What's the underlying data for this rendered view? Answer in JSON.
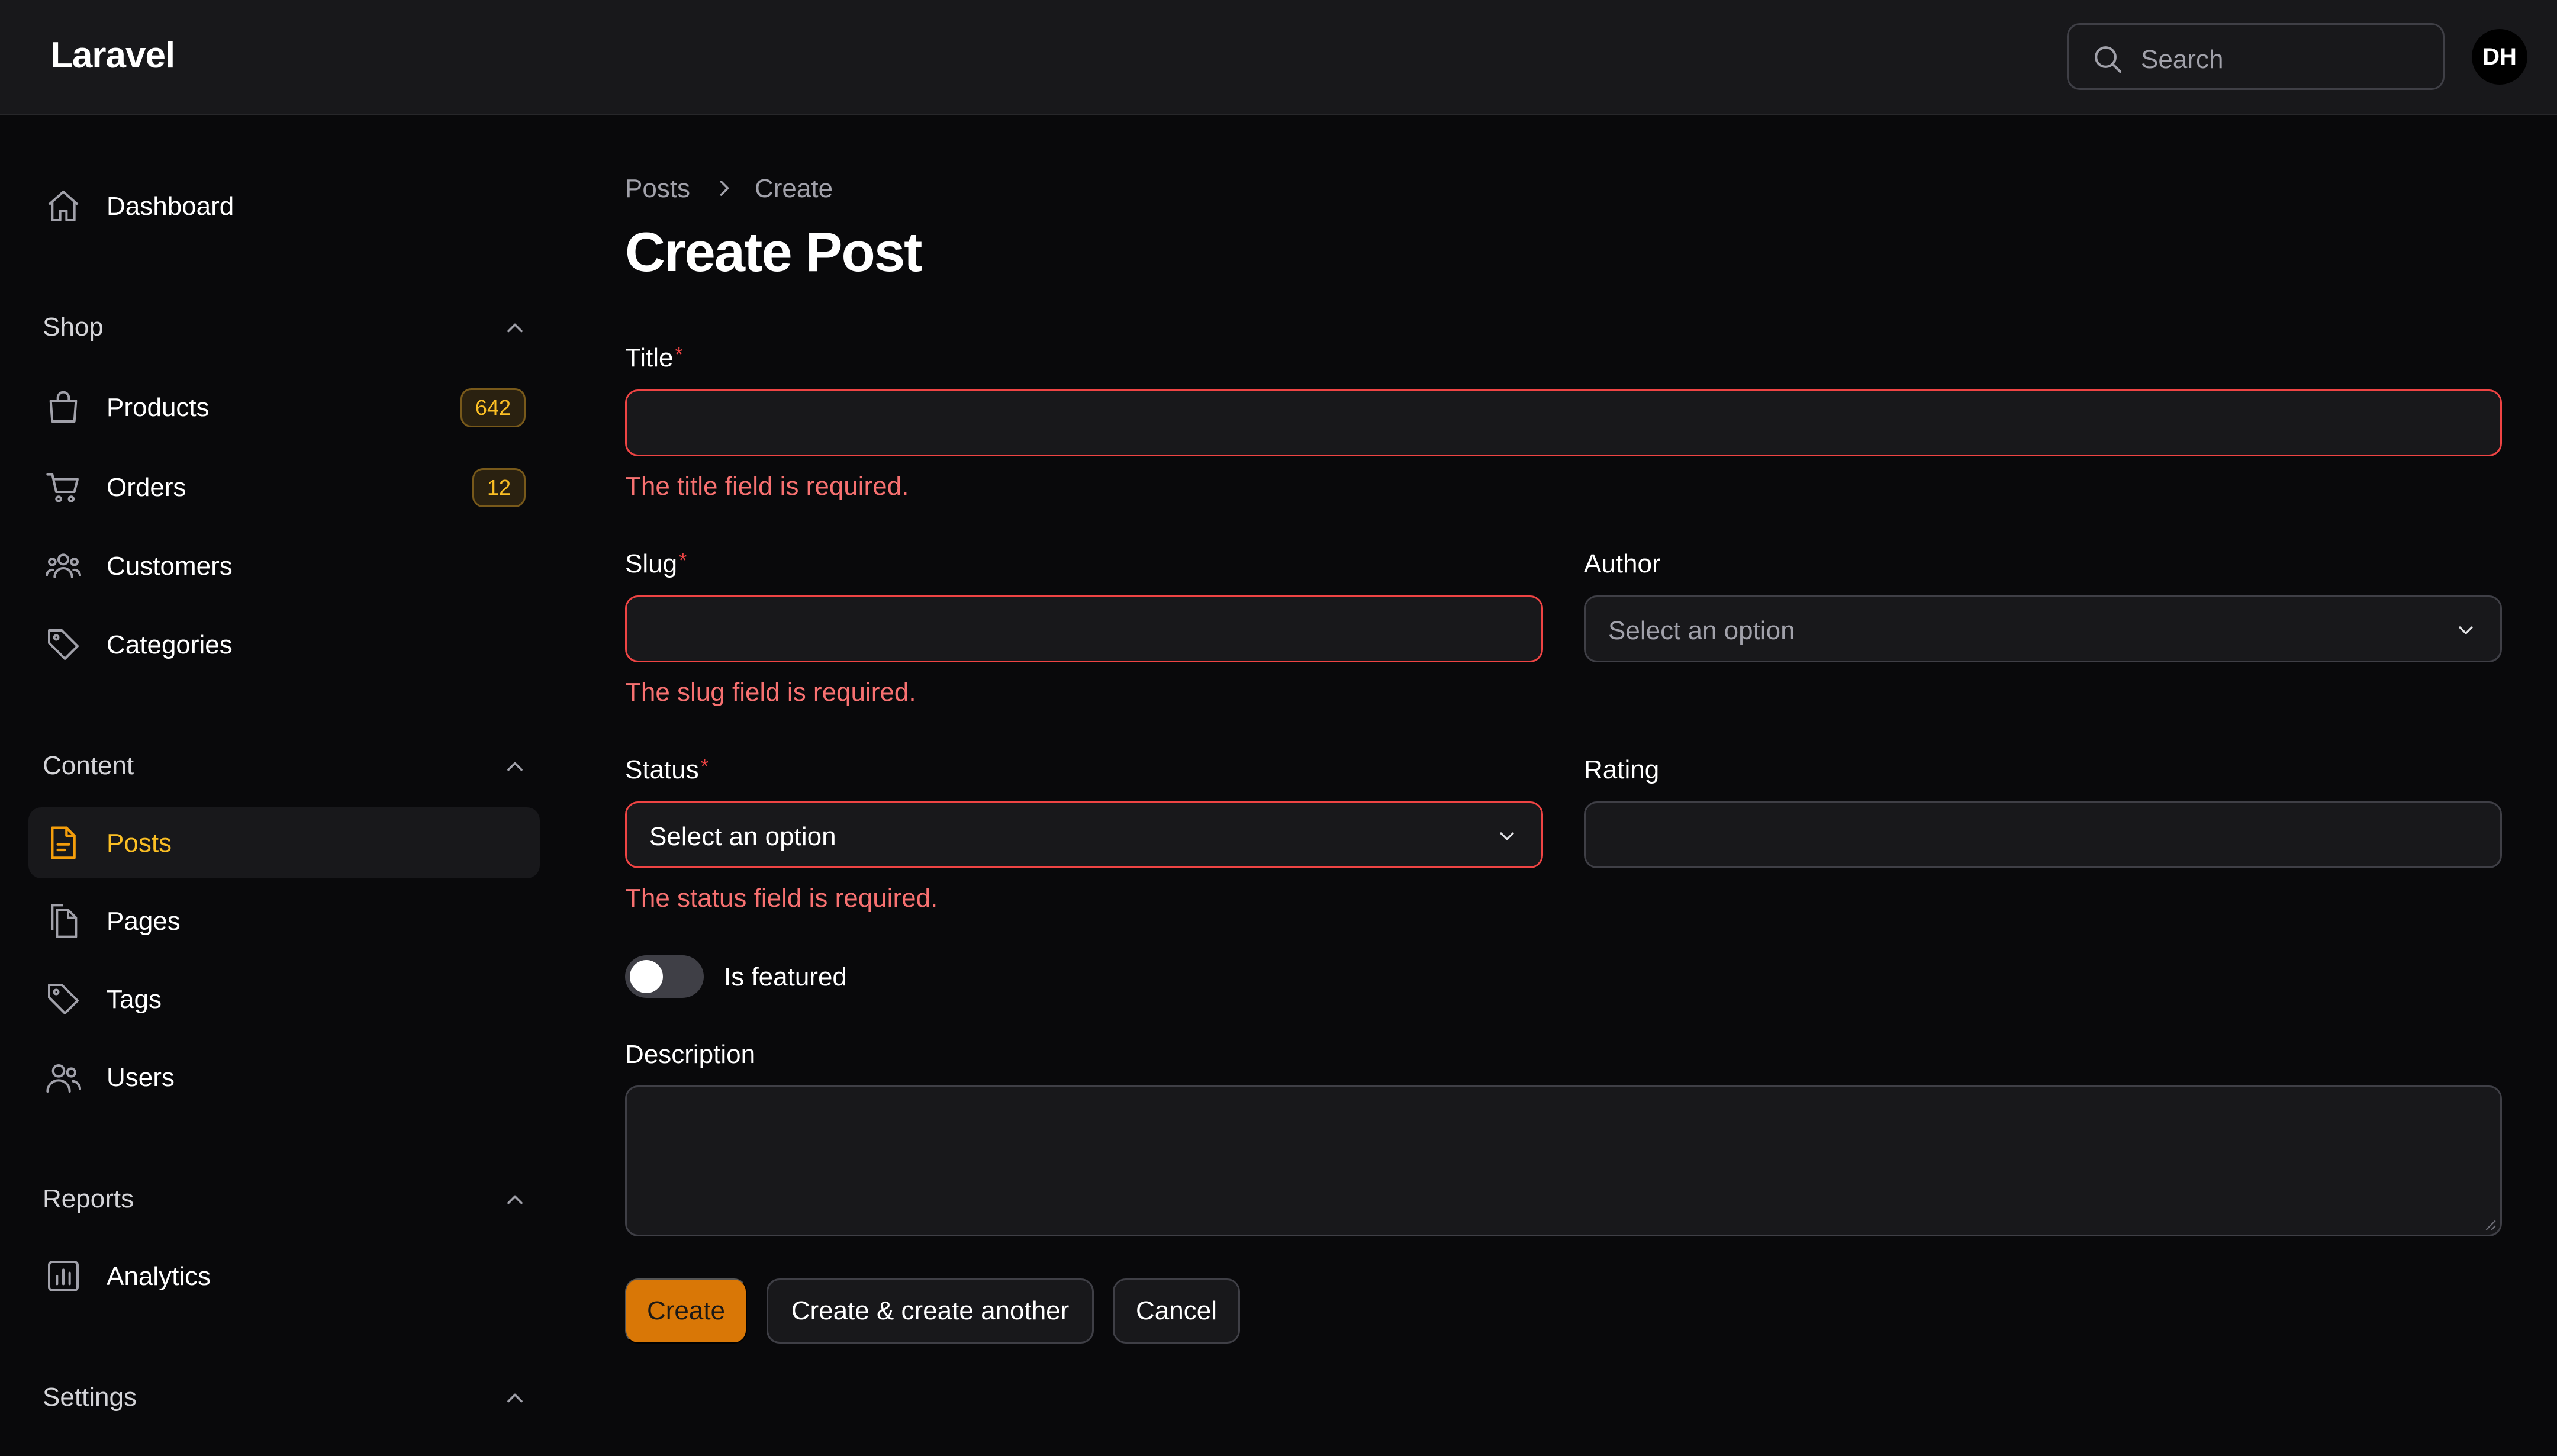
{
  "app": {
    "brand": "Laravel"
  },
  "header": {
    "search_placeholder": "Search",
    "avatar_initials": "DH"
  },
  "sidebar": {
    "dashboard": "Dashboard",
    "groups": {
      "shop": "Shop",
      "content": "Content",
      "reports": "Reports",
      "settings": "Settings"
    },
    "items": {
      "products": {
        "label": "Products",
        "badge": "642"
      },
      "orders": {
        "label": "Orders",
        "badge": "12"
      },
      "customers": {
        "label": "Customers"
      },
      "categories": {
        "label": "Categories"
      },
      "posts": {
        "label": "Posts"
      },
      "pages": {
        "label": "Pages"
      },
      "tags": {
        "label": "Tags"
      },
      "users": {
        "label": "Users"
      },
      "analytics": {
        "label": "Analytics"
      }
    },
    "active_item": "posts"
  },
  "main": {
    "breadcrumb": [
      "Posts",
      "Create"
    ],
    "title": "Create Post",
    "form": {
      "title": {
        "label": "Title",
        "required_mark": "*",
        "value": "",
        "error": "The title field is required."
      },
      "slug": {
        "label": "Slug",
        "required_mark": "*",
        "value": "",
        "error": "The slug field is required."
      },
      "author": {
        "label": "Author",
        "placeholder": "Select an option"
      },
      "status": {
        "label": "Status",
        "required_mark": "*",
        "selected": "Select an option",
        "error": "The status field is required."
      },
      "rating": {
        "label": "Rating",
        "value": ""
      },
      "featured": {
        "label": "Is featured",
        "checked": false
      },
      "description": {
        "label": "Description",
        "value": ""
      }
    },
    "actions": {
      "create": "Create",
      "create_another": "Create & create another",
      "cancel": "Cancel"
    }
  },
  "colors": {
    "accent": "#f59e0b",
    "primary_button": "#d97706",
    "error": "#ef4444",
    "background": "#09090b",
    "surface": "#18181b"
  }
}
